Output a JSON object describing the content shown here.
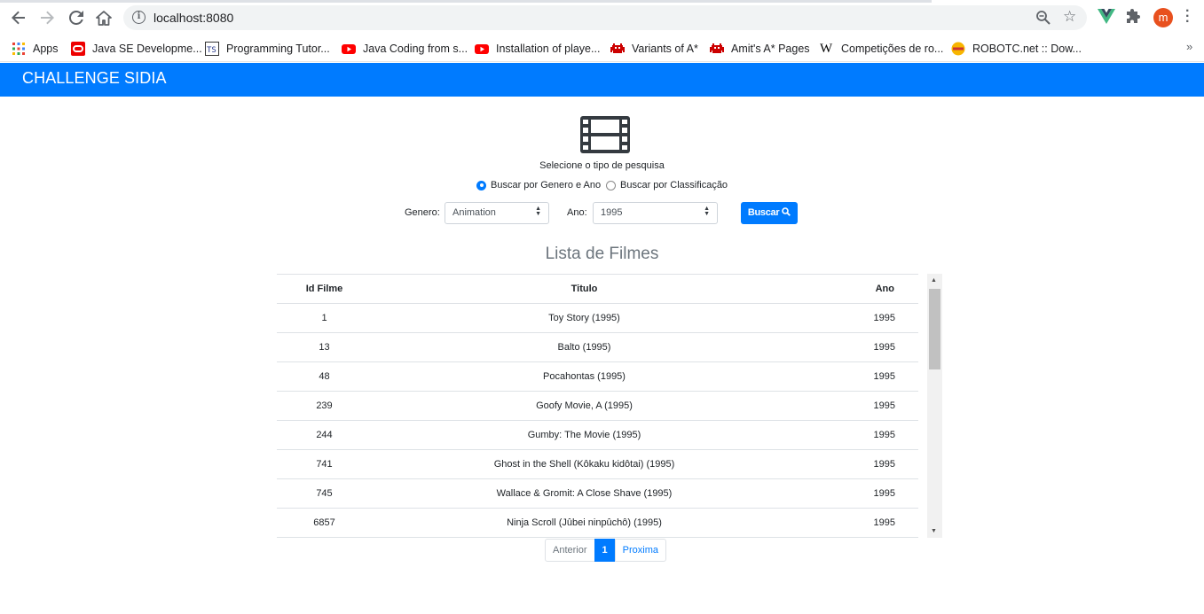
{
  "browser": {
    "url": "localhost:8080",
    "avatar_letter": "m",
    "bookmarks": [
      {
        "label": "Apps",
        "icon": "apps-grid-icon"
      },
      {
        "label": "Java SE Developme...",
        "icon": "oracle-icon"
      },
      {
        "label": "Programming Tutor...",
        "icon": "tutorial-icon"
      },
      {
        "label": "Java Coding from s...",
        "icon": "youtube-icon"
      },
      {
        "label": "Installation of playe...",
        "icon": "youtube-icon"
      },
      {
        "label": "Variants of A*",
        "icon": "invader-icon"
      },
      {
        "label": "Amit's A* Pages",
        "icon": "invader-icon"
      },
      {
        "label": "Competições de ro...",
        "icon": "wikipedia-icon"
      },
      {
        "label": "ROBOTC.net :: Dow...",
        "icon": "robotc-icon"
      }
    ],
    "more": "»"
  },
  "navbar": {
    "brand": "CHALLENGE SIDIA",
    "color": "#007bff"
  },
  "search": {
    "caption": "Selecione o tipo de pesquisa",
    "radio_genre_year": "Buscar por Genero e Ano",
    "radio_classification": "Buscar por Classificação",
    "selected_mode": "genre_year",
    "genre_label": "Genero:",
    "genre_value": "Animation",
    "year_label": "Ano:",
    "year_value": "1995",
    "button": "Buscar"
  },
  "list": {
    "title": "Lista de Filmes",
    "columns": [
      "Id Filme",
      "Titulo",
      "Ano"
    ],
    "rows": [
      [
        "1",
        "Toy Story (1995)",
        "1995"
      ],
      [
        "13",
        "Balto (1995)",
        "1995"
      ],
      [
        "48",
        "Pocahontas (1995)",
        "1995"
      ],
      [
        "239",
        "Goofy Movie, A (1995)",
        "1995"
      ],
      [
        "244",
        "Gumby: The Movie (1995)",
        "1995"
      ],
      [
        "741",
        "Ghost in the Shell (Kôkaku kidôtai) (1995)",
        "1995"
      ],
      [
        "745",
        "Wallace & Gromit: A Close Shave (1995)",
        "1995"
      ],
      [
        "6857",
        "Ninja Scroll (Jûbei ninpûchô) (1995)",
        "1995"
      ]
    ]
  },
  "pagination": {
    "prev": "Anterior",
    "current": "1",
    "next": "Proxima"
  }
}
